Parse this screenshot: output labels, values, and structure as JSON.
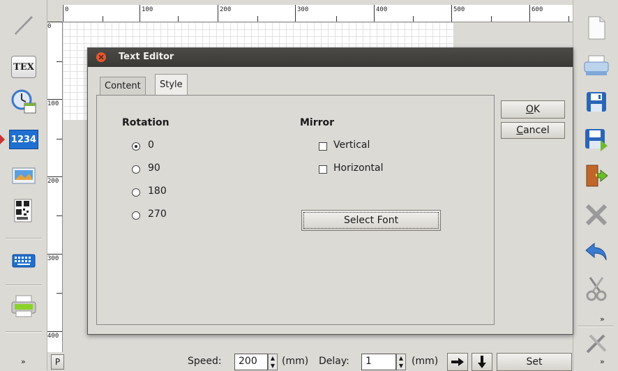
{
  "ruler": {
    "h_labels": [
      "0",
      "100",
      "200",
      "300",
      "400",
      "500",
      "600"
    ],
    "v_labels": [
      "0",
      "100",
      "200",
      "300",
      "400"
    ]
  },
  "left_toolbar": {
    "items": [
      {
        "name": "pencil-icon"
      },
      {
        "name": "tex-icon",
        "text": "TEX"
      },
      {
        "name": "clock-calendar-icon"
      },
      {
        "name": "counter-icon",
        "text": "1234"
      },
      {
        "name": "image-icon"
      },
      {
        "name": "barcode-icon"
      },
      {
        "name": "keyboard-icon"
      },
      {
        "name": "printer-icon"
      }
    ],
    "more": "»"
  },
  "right_toolbar": {
    "items": [
      {
        "name": "new-file-icon"
      },
      {
        "name": "printer-icon"
      },
      {
        "name": "save-icon"
      },
      {
        "name": "save-as-icon"
      },
      {
        "name": "exit-icon"
      },
      {
        "name": "close-icon"
      },
      {
        "name": "undo-icon"
      },
      {
        "name": "cut-icon"
      },
      {
        "name": "settings-tools-icon"
      }
    ],
    "more1": "»",
    "more2": "»"
  },
  "dialog": {
    "title": "Text Editor",
    "tabs": [
      {
        "label": "Content",
        "active": false
      },
      {
        "label": "Style",
        "active": true
      }
    ],
    "rotation": {
      "header": "Rotation",
      "options": [
        {
          "label": "0",
          "selected": true
        },
        {
          "label": "90",
          "selected": false
        },
        {
          "label": "180",
          "selected": false
        },
        {
          "label": "270",
          "selected": false
        }
      ]
    },
    "mirror": {
      "header": "Mirror",
      "options": [
        {
          "label": "Vertical",
          "checked": false
        },
        {
          "label": "Horizontal",
          "checked": false
        }
      ]
    },
    "select_font": "Select Font",
    "ok_prefix": "",
    "ok_mnemonic": "O",
    "ok_rest": "K",
    "cancel_mnemonic": "C",
    "cancel_rest": "ancel"
  },
  "bottom": {
    "p_label": "P",
    "speed_label": "Speed:",
    "speed_value": "200",
    "speed_unit": "(mm)",
    "delay_label": "Delay:",
    "delay_value": "1",
    "delay_unit": "(mm)",
    "set_label": "Set"
  },
  "colors": {
    "accent_blue": "#1f6fd0",
    "close_orange": "#e7582d",
    "indicator_red": "#cc3333"
  }
}
